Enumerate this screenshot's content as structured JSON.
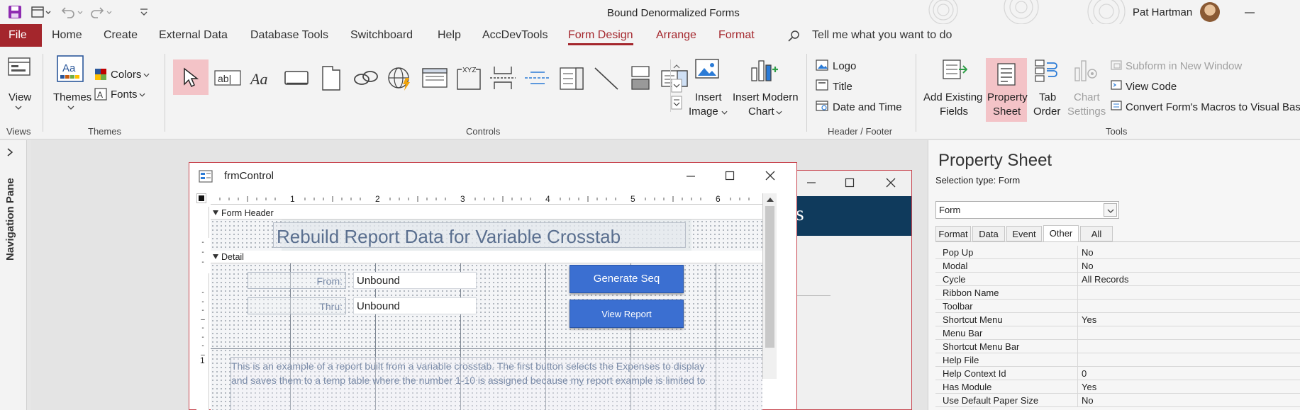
{
  "title_bar": {
    "document_title": "Bound Denormalized Forms",
    "user_name": "Pat Hartman"
  },
  "menu": {
    "file": "File",
    "tabs": [
      "Home",
      "Create",
      "External Data",
      "Database Tools",
      "Switchboard",
      "Help",
      "AccDevTools",
      "Form Design",
      "Arrange",
      "Format"
    ],
    "search_text": "Tell me what you want to do"
  },
  "ribbon": {
    "views": {
      "view": "View",
      "group": "Views"
    },
    "themes": {
      "themes": "Themes",
      "colors": "Colors",
      "fonts": "Fonts",
      "group": "Themes"
    },
    "controls": {
      "group": "Controls"
    },
    "insert": {
      "image_l1": "Insert",
      "image_l2": "Image",
      "chart_l1": "Insert Modern",
      "chart_l2": "Chart"
    },
    "header_footer": {
      "logo": "Logo",
      "title": "Title",
      "date_time": "Date and Time",
      "group": "Header / Footer"
    },
    "tools": {
      "add_l1": "Add Existing",
      "add_l2": "Fields",
      "prop_l1": "Property",
      "prop_l2": "Sheet",
      "tab_l1": "Tab",
      "tab_l2": "Order",
      "chart_l1": "Chart",
      "chart_l2": "Settings",
      "subform": "Subform in New Window",
      "view_code": "View Code",
      "convert": "Convert Form's Macros to Visual Basic",
      "group": "Tools"
    }
  },
  "nav_pane": {
    "label": "Navigation Pane"
  },
  "form_window": {
    "title": "frmControl",
    "ruler": [
      "1",
      "2",
      "3",
      "4",
      "5",
      "6"
    ],
    "vruler": "1",
    "section_header": "Form Header",
    "section_detail": "Detail",
    "header_label": "Rebuild Report Data for Variable Crosstab",
    "from_label": "From:",
    "from_value": "Unbound",
    "thru_label": "Thru:",
    "thru_value": "Unbound",
    "btn_generate": "Generate Seq",
    "btn_view": "View Report",
    "desc_line1": "This is an example of a report built from a variable crosstab.  The first button selects the Expenses to display",
    "desc_line2": "and saves them to a temp table where the number 1-10 is assigned because my report example is limited to"
  },
  "back_window": {
    "title_fragment": "s"
  },
  "property_sheet": {
    "title": "Property Sheet",
    "selection_label": "Selection type:  Form",
    "combo_value": "Form",
    "tabs": [
      "Format",
      "Data",
      "Event",
      "Other",
      "All"
    ],
    "active_tab": "Other",
    "rows": [
      {
        "name": "Pop Up",
        "value": "No"
      },
      {
        "name": "Modal",
        "value": "No"
      },
      {
        "name": "Cycle",
        "value": "All Records"
      },
      {
        "name": "Ribbon Name",
        "value": ""
      },
      {
        "name": "Toolbar",
        "value": ""
      },
      {
        "name": "Shortcut Menu",
        "value": "Yes"
      },
      {
        "name": "Menu Bar",
        "value": ""
      },
      {
        "name": "Shortcut Menu Bar",
        "value": ""
      },
      {
        "name": "Help File",
        "value": ""
      },
      {
        "name": "Help Context Id",
        "value": "0"
      },
      {
        "name": "Has Module",
        "value": "Yes"
      },
      {
        "name": "Use Default Paper Size",
        "value": "No"
      }
    ]
  },
  "colors": {
    "accent": "#a4262c",
    "button_blue": "#3b6fd1",
    "header_band": "#0f3a5c"
  }
}
